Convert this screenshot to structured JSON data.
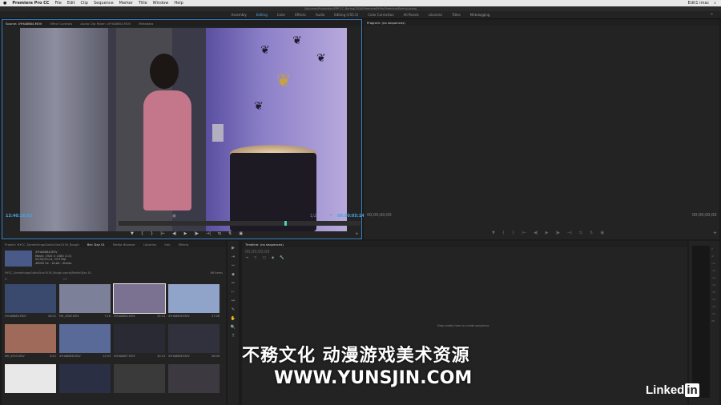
{
  "menubar": {
    "app": "Premiere Pro CC",
    "items": [
      "File",
      "Edit",
      "Clip",
      "Sequence",
      "Marker",
      "Title",
      "Window",
      "Help"
    ],
    "right": [
      "Edit1 imac"
    ]
  },
  "titlebar": {
    "path": "/Volumes/Production/FPP CC_Boring/2016/Premiere/PrPro/Premiere/Boring.prproj"
  },
  "workspaces": {
    "items": [
      "Assembly",
      "Editing",
      "Color",
      "Effects",
      "Audio",
      "Editing (CS5.5)",
      "Color Correction",
      "All Panels",
      "Libraries",
      "Titles",
      "Metalogging"
    ],
    "active": "Editing",
    "more": "»"
  },
  "source": {
    "tabs": [
      "Source: 4YHA8684.MOV",
      "Effect Controls",
      "Audio Clip Mixer: 4YHA8684.MOV",
      "Metadata"
    ],
    "timecode_in": "13:40:16:03",
    "fit": "Fit",
    "resolution": "1/2",
    "timecode_out": "00:00:05:14",
    "transport": [
      "▼",
      "{",
      "}",
      "|←",
      "◀|",
      "▶",
      "|▶",
      "→|",
      "⇆",
      "⇅",
      "▣"
    ],
    "add": "+"
  },
  "program": {
    "tabs": [
      "Program: (no sequences)"
    ],
    "timecode_in": "00;00;00;00",
    "timecode_out": "00;00;00;00",
    "transport": [
      "▼",
      "{",
      "}",
      "|←",
      "◀|",
      "▶",
      "|▶",
      "→|",
      "⇆",
      "⇅",
      "▣"
    ],
    "add": "+"
  },
  "project": {
    "tabs": [
      "Project: NYCC_SomethingsGottaGive2016_Rough",
      "Bin: Day 01",
      "Media Browser",
      "Libraries",
      "Info",
      "Effects"
    ],
    "info": {
      "name": "4YHA8684.MOV",
      "line1": "Movie, 1920 × 1080 (1.0)",
      "line2": "00;00;05;14, 23.976p",
      "line3": "48000 Hz - 16-bit - Stereo"
    },
    "path": "NYCC_SomethingsGottaGive2016_Rough.prproj\\Media\\Day 01",
    "count": "66 Items",
    "items": [
      {
        "name": "4YHA8684.MOV",
        "dur": "08:22",
        "color": "#3a4a6e"
      },
      {
        "name": "MH_4985.MOV",
        "dur": "7:16",
        "color": "#7c8098"
      },
      {
        "name": "4YHA8684.MOV",
        "dur": "25:14",
        "color": "#7a7290"
      },
      {
        "name": "4YHA8696.MOV",
        "dur": "37:06",
        "color": "#8fa4c8"
      },
      {
        "name": "MH_4953.MOV",
        "dur": "8:01",
        "color": "#a06a5a"
      },
      {
        "name": "4YHA8686.MOV",
        "dur": "12:03",
        "color": "#5a6a98"
      },
      {
        "name": "4YHA8687.MOV",
        "dur": "30:14",
        "color": "#2a2a34"
      },
      {
        "name": "4YHA8688.MOV",
        "dur": "08:06",
        "color": "#30313c"
      },
      {
        "name": "",
        "dur": "",
        "color": "#e8e8e8"
      },
      {
        "name": "",
        "dur": "",
        "color": "#2a2f44"
      },
      {
        "name": "",
        "dur": "",
        "color": "#3a3a3a"
      },
      {
        "name": "",
        "dur": "",
        "color": "#3c3a40"
      }
    ]
  },
  "tools": [
    "▶",
    "⇥",
    "⇿",
    "◆",
    "✂",
    "⊢",
    "↔",
    "✎",
    "✋",
    "🔍",
    "T"
  ],
  "timeline": {
    "tab": "Timeline: (no sequences)",
    "timecode": "00;00;00;00",
    "icons": [
      "⇥",
      "⊃",
      "▢",
      "◆",
      "🔧"
    ],
    "drop": "Drop media here to create sequence."
  },
  "meters": {
    "scale": [
      "0",
      "-6",
      "-12",
      "-18",
      "-24",
      "-30",
      "-36",
      "-42",
      "-48",
      "-54",
      "dB"
    ]
  },
  "overlay": {
    "line1": "不務文化 动漫游戏美术资源",
    "line2": "WWW.YUNSJIN.COM",
    "brand": "Linked",
    "brand_in": "in"
  },
  "colors": {
    "accent": "#4aa3e0",
    "selection": "#3a7fc1",
    "playhead": "#4ed1b8"
  }
}
